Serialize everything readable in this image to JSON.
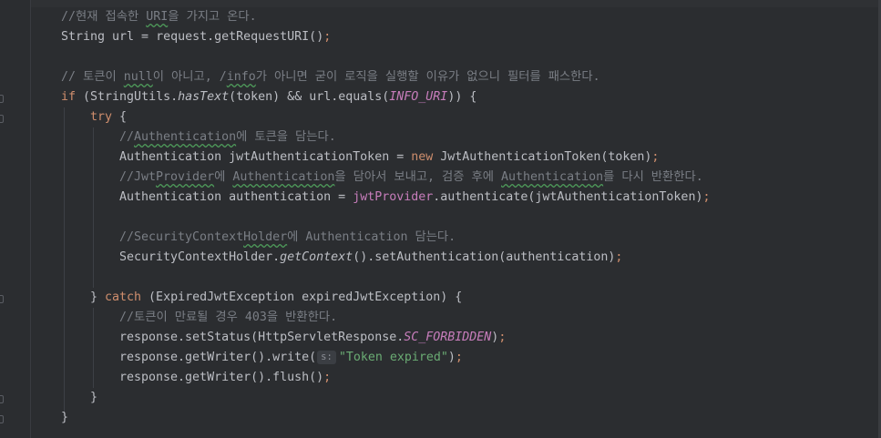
{
  "colors": {
    "background": "#2b2d30",
    "text": "#bcbec4",
    "keyword": "#cf8e6d",
    "comment": "#7a7e85",
    "constant": "#c77dbb",
    "string": "#6aab73",
    "hint_background": "#3b3e43"
  },
  "lines": [
    {
      "indent": 0,
      "tokens": [
        {
          "t": "//현재 접속한 ",
          "c": "cm"
        },
        {
          "t": "URI",
          "c": "cm",
          "ul": true
        },
        {
          "t": "을 가지고 온다.",
          "c": "cm"
        }
      ]
    },
    {
      "indent": 0,
      "tokens": [
        {
          "t": "String url = request.getRequestURI()",
          "c": "def"
        },
        {
          "t": ";",
          "c": "semi"
        }
      ]
    },
    {
      "indent": 0,
      "tokens": []
    },
    {
      "indent": 0,
      "tokens": [
        {
          "t": "// 토큰이 ",
          "c": "cm"
        },
        {
          "t": "null",
          "c": "cm",
          "ul": true
        },
        {
          "t": "이 아니고, /",
          "c": "cm"
        },
        {
          "t": "info",
          "c": "cm",
          "ul": true
        },
        {
          "t": "가 아니면 굳이 로직을 실행할 이유가 없으니 필터를 패스한다.",
          "c": "cm"
        }
      ]
    },
    {
      "indent": 0,
      "tokens": [
        {
          "t": "if",
          "c": "kw"
        },
        {
          "t": " (StringUtils.",
          "c": "def"
        },
        {
          "t": "hasText",
          "c": "it"
        },
        {
          "t": "(token) && url.equals(",
          "c": "def"
        },
        {
          "t": "INFO_URI",
          "c": "cst"
        },
        {
          "t": ")) {",
          "c": "def"
        }
      ]
    },
    {
      "indent": 1,
      "tokens": [
        {
          "t": "try",
          "c": "kw"
        },
        {
          "t": " {",
          "c": "def"
        }
      ]
    },
    {
      "indent": 2,
      "tokens": [
        {
          "t": "//",
          "c": "cm"
        },
        {
          "t": "Authentication",
          "c": "cm",
          "ul": true
        },
        {
          "t": "에 토큰을 담는다.",
          "c": "cm"
        }
      ]
    },
    {
      "indent": 2,
      "tokens": [
        {
          "t": "Authentication jwtAuthenticationToken = ",
          "c": "def"
        },
        {
          "t": "new",
          "c": "kw"
        },
        {
          "t": " JwtAuthenticationToken(token)",
          "c": "def"
        },
        {
          "t": ";",
          "c": "semi"
        }
      ]
    },
    {
      "indent": 2,
      "tokens": [
        {
          "t": "//Jwt",
          "c": "cm"
        },
        {
          "t": "Provider",
          "c": "cm",
          "ul": true
        },
        {
          "t": "에 ",
          "c": "cm"
        },
        {
          "t": "Authentication",
          "c": "cm",
          "ul": true
        },
        {
          "t": "을 담아서 보내고, 검증 후에 ",
          "c": "cm"
        },
        {
          "t": "Authentication",
          "c": "cm",
          "ul": true
        },
        {
          "t": "를 다시 반환한다.",
          "c": "cm"
        }
      ]
    },
    {
      "indent": 2,
      "tokens": [
        {
          "t": "Authentication authentication = ",
          "c": "def"
        },
        {
          "t": "jwtProvider",
          "c": "fld"
        },
        {
          "t": ".authenticate(jwtAuthenticationToken)",
          "c": "def"
        },
        {
          "t": ";",
          "c": "semi"
        }
      ]
    },
    {
      "indent": 0,
      "tokens": []
    },
    {
      "indent": 2,
      "tokens": [
        {
          "t": "//SecurityContext",
          "c": "cm"
        },
        {
          "t": "Holder",
          "c": "cm",
          "ul": true
        },
        {
          "t": "에 Authentication 담는다.",
          "c": "cm"
        }
      ]
    },
    {
      "indent": 2,
      "tokens": [
        {
          "t": "SecurityContextHolder.",
          "c": "def"
        },
        {
          "t": "getContext",
          "c": "it"
        },
        {
          "t": "().setAuthentication(authentication)",
          "c": "def"
        },
        {
          "t": ";",
          "c": "semi"
        }
      ]
    },
    {
      "indent": 0,
      "tokens": []
    },
    {
      "indent": 1,
      "tokens": [
        {
          "t": "} ",
          "c": "def"
        },
        {
          "t": "catch",
          "c": "kw"
        },
        {
          "t": " (ExpiredJwtException expiredJwtException) {",
          "c": "def"
        }
      ]
    },
    {
      "indent": 2,
      "tokens": [
        {
          "t": "//토큰이 만료될 경우 403을 반환한다.",
          "c": "cm"
        }
      ]
    },
    {
      "indent": 2,
      "tokens": [
        {
          "t": "response.setStatus(HttpServletResponse.",
          "c": "def"
        },
        {
          "t": "SC_FORBIDDEN",
          "c": "cst"
        },
        {
          "t": ")",
          "c": "def"
        },
        {
          "t": ";",
          "c": "semi"
        }
      ]
    },
    {
      "indent": 2,
      "tokens": [
        {
          "t": "response.getWriter().write(",
          "c": "def"
        },
        {
          "t": "s:",
          "c": "hint"
        },
        {
          "t": "\"Token expired\"",
          "c": "str"
        },
        {
          "t": ")",
          "c": "def"
        },
        {
          "t": ";",
          "c": "semi"
        }
      ]
    },
    {
      "indent": 2,
      "tokens": [
        {
          "t": "response.getWriter().flush()",
          "c": "def"
        },
        {
          "t": ";",
          "c": "semi"
        }
      ]
    },
    {
      "indent": 1,
      "tokens": [
        {
          "t": "}",
          "c": "def"
        }
      ]
    },
    {
      "indent": 0,
      "tokens": [
        {
          "t": "}",
          "c": "def"
        }
      ]
    }
  ]
}
